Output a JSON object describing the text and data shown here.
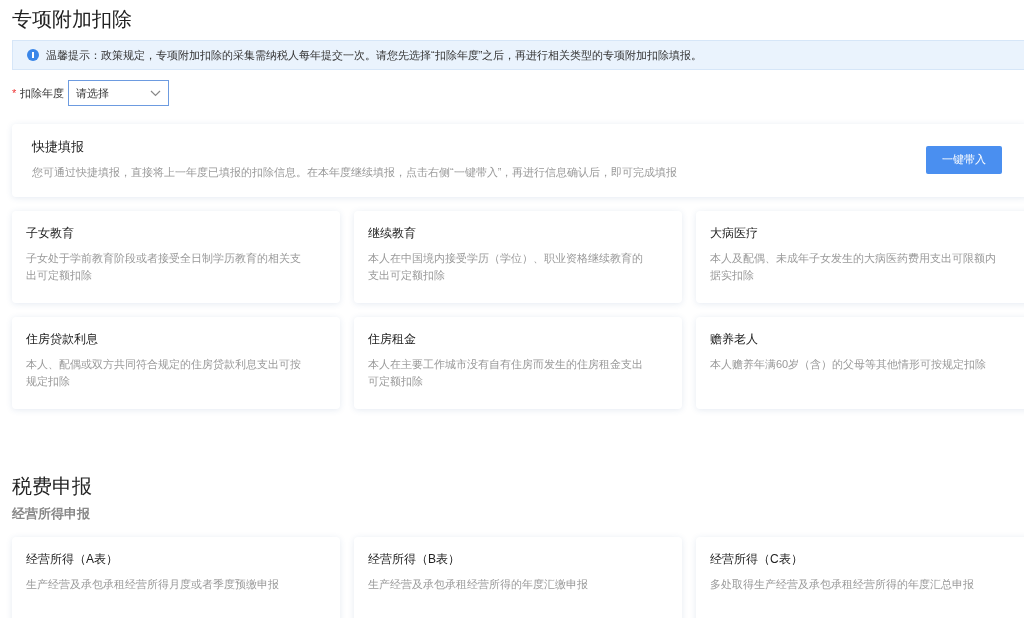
{
  "deduction": {
    "title": "专项附加扣除",
    "notice": "温馨提示：政策规定，专项附加扣除的采集需纳税人每年提交一次。请您先选择“扣除年度”之后，再进行相关类型的专项附加扣除填报。",
    "year_field": {
      "label": "扣除年度",
      "required_mark": "*",
      "placeholder": "请选择"
    },
    "quick_fill": {
      "title": "快捷填报",
      "description": "您可通过快捷填报，直接将上一年度已填报的扣除信息。在本年度继续填报，点击右侧“一键带入”，再进行信息确认后，即可完成填报",
      "button": "一键带入"
    },
    "items": [
      {
        "title": "子女教育",
        "description": "子女处于学前教育阶段或者接受全日制学历教育的相关支出可定额扣除"
      },
      {
        "title": "继续教育",
        "description": "本人在中国境内接受学历（学位）、职业资格继续教育的支出可定额扣除"
      },
      {
        "title": "大病医疗",
        "description": "本人及配偶、未成年子女发生的大病医药费用支出可限额内据实扣除"
      },
      {
        "title": "住房贷款利息",
        "description": "本人、配偶或双方共同符合规定的住房贷款利息支出可按规定扣除"
      },
      {
        "title": "住房租金",
        "description": "本人在主要工作城市没有自有住房而发生的住房租金支出可定额扣除"
      },
      {
        "title": "赡养老人",
        "description": "本人赡养年满60岁（含）的父母等其他情形可按规定扣除"
      }
    ]
  },
  "tax_filing": {
    "title": "税费申报",
    "subtitle": "经营所得申报",
    "items": [
      {
        "title": "经营所得（A表）",
        "description": "生产经营及承包承租经营所得月度或者季度预缴申报"
      },
      {
        "title": "经营所得（B表）",
        "description": "生产经营及承包承租经营所得的年度汇缴申报"
      },
      {
        "title": "经营所得（C表）",
        "description": "多处取得生产经营及承包承租经营所得的年度汇总申报"
      }
    ]
  }
}
